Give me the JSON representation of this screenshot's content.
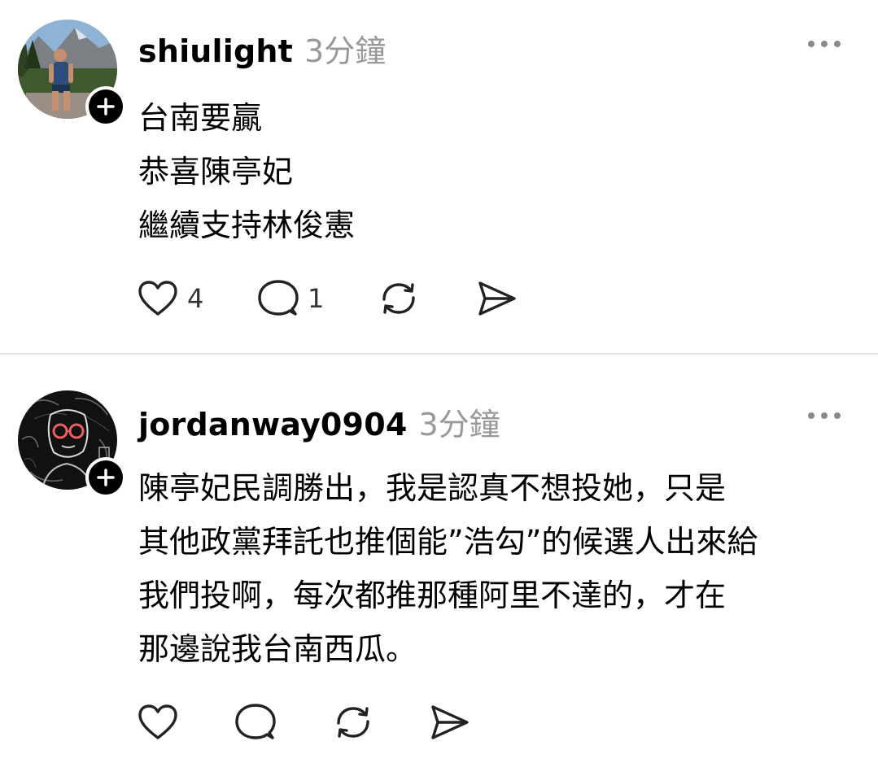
{
  "posts": [
    {
      "username": "shiulight",
      "timestamp": "3分鐘",
      "lines": [
        "台南要贏",
        "恭喜陳亭妃",
        "繼續支持林俊憲"
      ],
      "like_count": "4",
      "reply_count": "1"
    },
    {
      "username": "jordanway0904",
      "timestamp": "3分鐘",
      "lines": [
        "陳亭妃民調勝出，我是認真不想投她，只是",
        "其他政黨拜託也推個能”浩勾”的候選人出來給",
        "我們投啊，每次都推那種阿里不達的，才在",
        "那邊說我台南西瓜。"
      ]
    }
  ],
  "icons": {
    "follow": "plus-icon",
    "more": "more-icon",
    "like": "heart-icon",
    "reply": "comment-icon",
    "repost": "repost-icon",
    "share": "send-icon"
  }
}
